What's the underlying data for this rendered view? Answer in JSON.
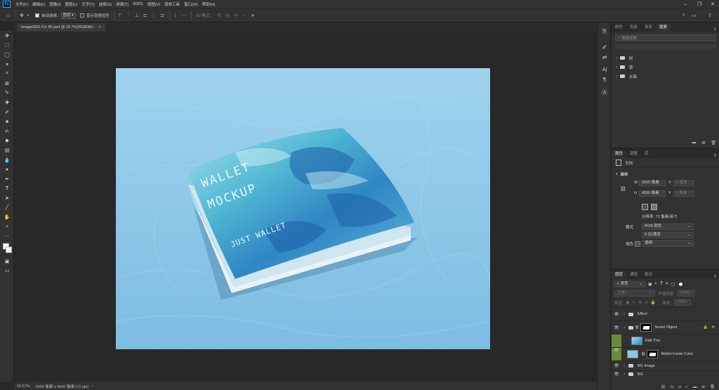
{
  "app": {
    "logo": "Ps"
  },
  "menu": [
    "文件(F)",
    "编辑(E)",
    "图像(I)",
    "图层(L)",
    "文字(Y)",
    "选择(S)",
    "滤镜(T)",
    "3D(D)",
    "视图(V)",
    "增效工具",
    "窗口(W)",
    "帮助(H)"
  ],
  "options": {
    "auto_select_label": "自动选择：",
    "auto_select_value": "图层",
    "show_transform_label": "显示变换控件",
    "mode_3d_label": "3D 模式："
  },
  "document": {
    "tab_title": "Image0001 Fix 3D.psd @ 16.7%(RGB/8#)",
    "close": "×"
  },
  "artwork": {
    "title_line1": "WALLET",
    "title_line2": "MOCKUP",
    "subtitle": "JUST WALLET"
  },
  "status": {
    "zoom": "16.67%",
    "info": "6000 像素 x 4500 像素 (72 ppi)"
  },
  "top_panel": {
    "tabs": [
      "颜色",
      "色板",
      "渐变",
      "图案"
    ],
    "active_tab": "图案",
    "search_placeholder": "搜索图案",
    "groups": [
      "树",
      "草",
      "水面"
    ]
  },
  "properties": {
    "tabs": [
      "属性",
      "调整",
      "库"
    ],
    "active_tab": "属性",
    "doc_label": "文档",
    "section": "画布",
    "w_label": "W",
    "w_value": "6000 像素",
    "x_label": "X",
    "x_value": "0 像素",
    "h_label": "H",
    "h_value": "4500 像素",
    "y_label": "Y",
    "y_value": "0 像素",
    "resolution": "分辨率: 72 像素/英寸",
    "mode_label": "模式",
    "mode_value": "RGB 颜色",
    "depth_value": "8 位/通道",
    "fill_label": "填色",
    "fill_value": "透明"
  },
  "layers": {
    "tabs": [
      "图层",
      "通道",
      "路径"
    ],
    "active_tab": "图层",
    "filter_label": "类型",
    "blend_mode": "正常",
    "opacity_label": "不透明度:",
    "opacity_value": "100%",
    "lock_label": "锁定:",
    "fill_label": "填充:",
    "fill_value": "100%",
    "items": [
      {
        "name": "Effect",
        "kind": "group"
      },
      {
        "name": "Smart Object",
        "kind": "group-mask",
        "fx": "fx"
      },
      {
        "name": "Edit This",
        "kind": "smart"
      },
      {
        "name": "Wallet Inside Color",
        "kind": "mask"
      },
      {
        "name": "BG Image",
        "kind": "group"
      },
      {
        "name": "BG",
        "kind": "group"
      }
    ]
  }
}
